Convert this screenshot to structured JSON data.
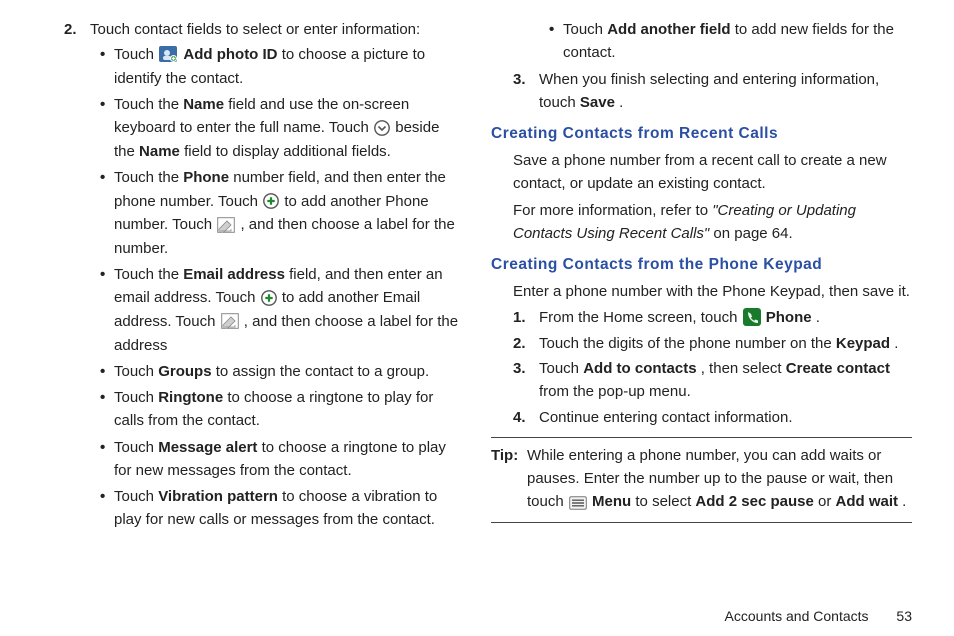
{
  "left": {
    "step2": {
      "num": "2.",
      "text_a": "Touch contact fields to select or enter information:",
      "bullets": [
        {
          "pre": "Touch ",
          "icon": "photo-id",
          "bold1": "Add photo ID",
          "post": " to choose a picture to identify the contact."
        },
        {
          "pre": "Touch the ",
          "bold1": "Name",
          "mid1": " field and use the on-screen keyboard to enter the full name. Touch ",
          "icon": "chevron",
          "mid2": " beside the ",
          "bold2": "Name",
          "post": " field to display additional fields."
        },
        {
          "pre": "Touch the ",
          "bold1": "Phone",
          "mid1": " number field, and then enter the phone number. Touch ",
          "icon": "plus",
          "mid2": " to add another Phone number. Touch ",
          "icon2": "label",
          "post": ", and then choose a label for the number."
        },
        {
          "pre": "Touch the ",
          "bold1": "Email address",
          "mid1": " field, and then enter an email address. Touch ",
          "icon": "plus",
          "mid2": " to add another Email address. Touch ",
          "icon2": "label",
          "post": ", and then choose a label for the address"
        },
        {
          "pre": "Touch ",
          "bold1": "Groups",
          "post": " to assign the contact to a group."
        },
        {
          "pre": "Touch ",
          "bold1": "Ringtone",
          "post": " to choose a ringtone to play for calls from the contact."
        },
        {
          "pre": "Touch ",
          "bold1": "Message alert",
          "post": " to choose a ringtone to play for new messages from the contact."
        },
        {
          "pre": "Touch ",
          "bold1": "Vibration pattern",
          "post": " to choose a vibration to play for new calls or messages from the contact."
        }
      ]
    }
  },
  "right": {
    "cont_bullet": {
      "pre": "Touch ",
      "bold1": "Add another field",
      "post": " to add new fields for the contact."
    },
    "step3": {
      "num": "3.",
      "pre": "When you finish selecting and entering information, touch ",
      "bold1": "Save",
      "post": "."
    },
    "h1": "Creating Contacts from Recent Calls",
    "p1": "Save a phone number from a recent call to create a new contact, or update an existing contact.",
    "p2_pre": "For more information, refer to ",
    "p2_italic": "\"Creating or Updating Contacts Using Recent Calls\"",
    "p2_post": " on page 64.",
    "h2": "Creating Contacts from the Phone Keypad",
    "p3": "Enter a phone number with the Phone Keypad, then save it.",
    "steps2": [
      {
        "num": "1.",
        "pre": "From the Home screen, touch ",
        "icon": "phone",
        "bold1": "Phone",
        "post": "."
      },
      {
        "num": "2.",
        "pre": "Touch the digits of the phone number on the ",
        "bold1": "Keypad",
        "post": "."
      },
      {
        "num": "3.",
        "pre": "Touch ",
        "bold1": "Add to contacts",
        "mid1": ", then select ",
        "bold2": "Create contact",
        "post": " from the pop-up menu."
      },
      {
        "num": "4.",
        "pre": "Continue entering contact information."
      }
    ],
    "tip": {
      "label": "Tip:",
      "pre": "While entering a phone number, you can add waits or pauses. Enter the number up to the pause or wait, then touch ",
      "icon": "menu",
      "bold1": "Menu",
      "mid1": " to select ",
      "bold2": "Add 2 sec pause",
      "mid2": " or ",
      "bold3": "Add wait",
      "post": "."
    },
    "footer_section": "Accounts and Contacts",
    "footer_page": "53"
  },
  "chart_data": null
}
